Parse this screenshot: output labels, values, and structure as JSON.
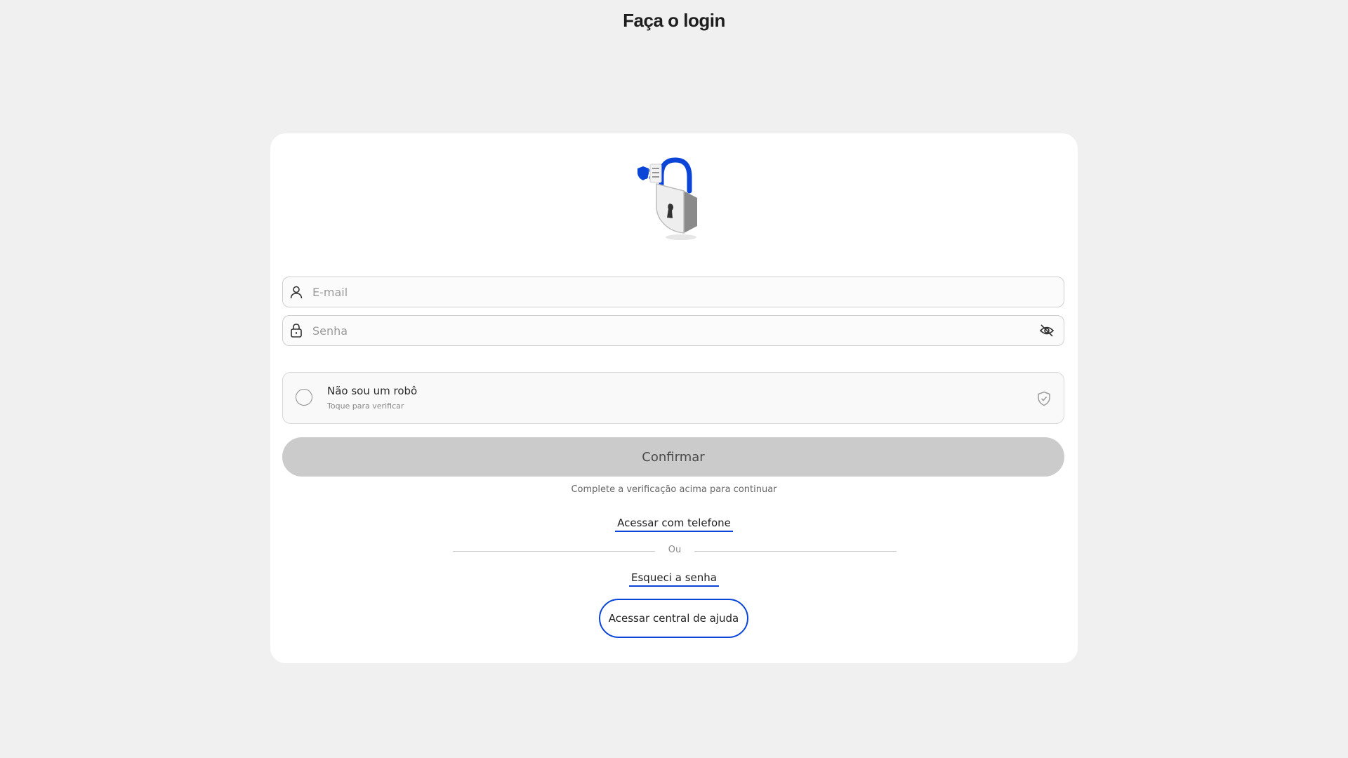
{
  "header": {
    "title": "Faça o login"
  },
  "form": {
    "email_placeholder": "E-mail",
    "email_value": "",
    "password_placeholder": "Senha",
    "password_value": "",
    "icons": {
      "email": "user-icon",
      "password": "lock-icon",
      "visibility": "eye-off-icon"
    }
  },
  "captcha": {
    "title": "Não sou um robô",
    "subtitle": "Toque para verificar",
    "checked": false,
    "icon": "shield-check-icon"
  },
  "actions": {
    "confirm_label": "Confirmar",
    "hint": "Complete a verificação acima para continuar",
    "phone_link": "Acessar com telefone",
    "or_label": "Ou",
    "forgot_link": "Esqueci a senha",
    "help_button": "Acessar central de ajuda"
  },
  "colors": {
    "accent": "#0a45d8",
    "background": "#f0f0f0",
    "card": "#ffffff",
    "button_disabled": "#cbcbcb"
  }
}
